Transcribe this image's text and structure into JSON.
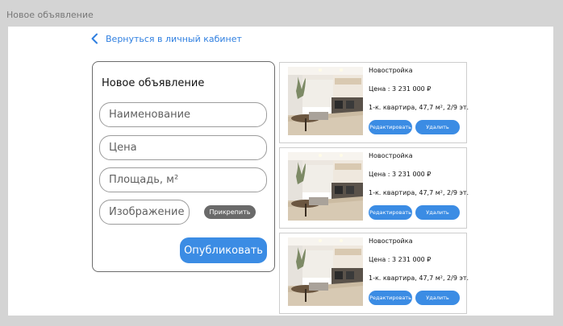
{
  "window": {
    "title": "Новое объявление"
  },
  "nav": {
    "back_label": "Вернуться в личный кабинет"
  },
  "form": {
    "title": "Новое объявление",
    "name_placeholder": "Наименование",
    "price_placeholder": "Цена",
    "area_placeholder": "Площадь, м²",
    "image_placeholder": "Изображение",
    "attach_label": "Прикрепить",
    "publish_label": "Опубликовать"
  },
  "colors": {
    "accent": "#3b8ce4",
    "link": "#2f7fe0",
    "attach_button": "#6a6a6a"
  },
  "listings": [
    {
      "type": "Новостройка",
      "price": "Цена : 3 231 000 ₽",
      "description": "1-к. квартира, 47,7 м², 2/9 эт.",
      "edit_label": "Редактировать",
      "delete_label": "Удалить"
    },
    {
      "type": "Новостройка",
      "price": "Цена : 3 231 000 ₽",
      "description": "1-к. квартира, 47,7 м², 2/9 эт.",
      "edit_label": "Редактировать",
      "delete_label": "Удалить"
    },
    {
      "type": "Новостройка",
      "price": "Цена : 3 231 000 ₽",
      "description": "1-к. квартира, 47,7 м², 2/9 эт.",
      "edit_label": "Редактировать",
      "delete_label": "Удалить"
    }
  ]
}
